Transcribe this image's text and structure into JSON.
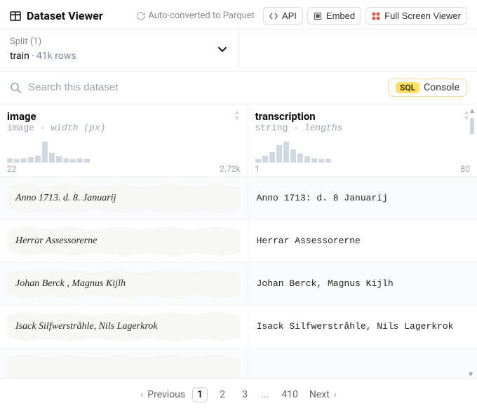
{
  "header": {
    "title": "Dataset Viewer",
    "auto_convert": "Auto-converted to Parquet",
    "api_btn": "API",
    "embed_btn": "Embed",
    "fullscreen_btn": "Full Screen Viewer"
  },
  "split": {
    "label": "Split (1)",
    "name": "train",
    "rows": "41k rows"
  },
  "search": {
    "placeholder": "Search this dataset",
    "sql_badge": "SQL",
    "sql_label": "Console"
  },
  "columns": {
    "image": {
      "title": "image",
      "type": "image",
      "meta": "width (px)",
      "hist": {
        "min": "22",
        "max": "2.72k",
        "bars": [
          3,
          2,
          3,
          4,
          6,
          22,
          9,
          5,
          3,
          2,
          3,
          2
        ]
      }
    },
    "transcription": {
      "title": "transcription",
      "type": "string",
      "meta": "lengths",
      "hist": {
        "min": "1",
        "max": "80",
        "bars": [
          2,
          6,
          10,
          18,
          22,
          13,
          8,
          5,
          3,
          2,
          2
        ]
      }
    }
  },
  "rows": [
    {
      "img_text": "Anno 1713. d. 8. Januarij",
      "transcription": "Anno 1713: d. 8 Januarij"
    },
    {
      "img_text": "Herrar Assessorerne",
      "transcription": "Herrar Assessorerne"
    },
    {
      "img_text": "Johan Berck , Magnus Kijlh",
      "transcription": "Johan Berck, Magnus Kijlh"
    },
    {
      "img_text": "Isack Silfwerstråhle, Nils Lagerkrok",
      "transcription": "Isack Silfwerstråhle, Nils Lagerkrok"
    },
    {
      "img_text": "",
      "transcription": ""
    }
  ],
  "pager": {
    "prev": "Previous",
    "next": "Next",
    "pages": [
      "1",
      "2",
      "3"
    ],
    "ellipsis": "...",
    "last": "410"
  }
}
